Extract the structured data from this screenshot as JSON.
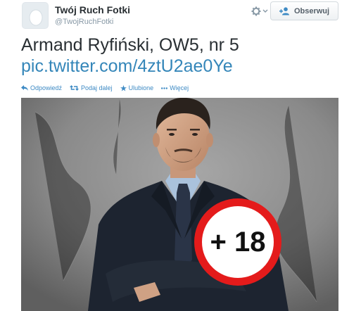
{
  "profile": {
    "display_name": "Twój Ruch Fotki",
    "screen_name": "@TwojRuchFotki"
  },
  "header": {
    "gear_icon": "gear-icon",
    "follow_label": "Obserwuj",
    "follow_icon": "add-user-icon"
  },
  "tweet": {
    "text": "Armand Ryfiński, OW5, nr 5",
    "link": "pic.twitter.com/4ztU2ae0Ye"
  },
  "actions": {
    "reply": "Odpowiedź",
    "retweet": "Podaj dalej",
    "favorite": "Ulubione",
    "more": "Więcej"
  },
  "photo": {
    "badge_text": "+ 18",
    "badge_color": "#e41b1b"
  },
  "colors": {
    "link": "#3486b9",
    "text": "#292f33",
    "muted": "#8899a6"
  }
}
